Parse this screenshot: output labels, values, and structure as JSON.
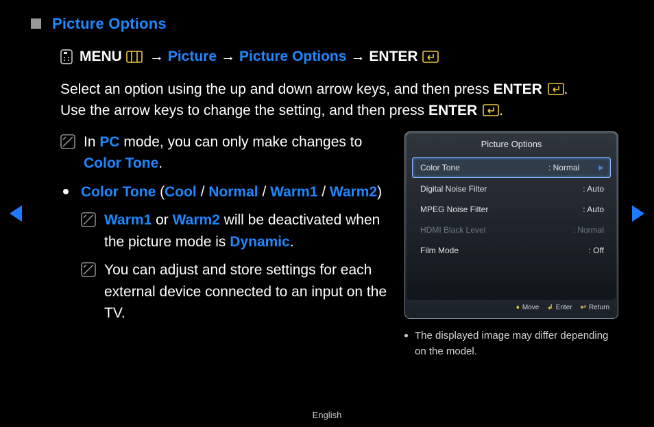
{
  "heading": {
    "title": "Picture Options"
  },
  "path": {
    "menu": "MENU",
    "picture": "Picture",
    "picture_options": "Picture Options",
    "enter": "ENTER",
    "arrow": "→"
  },
  "para": {
    "t1": "Select an option using the up and down arrow keys, and then press ",
    "enter1": "ENTER",
    "t2": ". Use the arrow keys to change the setting, and then press ",
    "enter2": "ENTER",
    "t3": "."
  },
  "note1": {
    "a": "In ",
    "pc": "PC",
    "b": " mode, you can only make changes to ",
    "ct": "Color Tone",
    "c": "."
  },
  "bullet": {
    "ct": "Color Tone",
    "open": " (",
    "cool": "Cool",
    "sep": " / ",
    "normal": "Normal",
    "warm1": "Warm1",
    "warm2": "Warm2",
    "close": ")"
  },
  "sub1": {
    "w1": "Warm1",
    "or": " or ",
    "w2": "Warm2",
    "rest": " will be deactivated when the picture mode is ",
    "dyn": "Dynamic",
    "dot": "."
  },
  "sub2": {
    "text": "You can adjust and store settings for each external device connected to an input on the TV."
  },
  "panel": {
    "title": "Picture Options",
    "items": [
      {
        "label": "Color Tone",
        "value": ": Normal",
        "state": "selected"
      },
      {
        "label": "Digital Noise Filter",
        "value": ": Auto",
        "state": ""
      },
      {
        "label": "MPEG Noise Filter",
        "value": ": Auto",
        "state": ""
      },
      {
        "label": "HDMI Black Level",
        "value": ": Normal",
        "state": "disabled"
      },
      {
        "label": "Film Mode",
        "value": ": Off",
        "state": ""
      }
    ],
    "footer": {
      "move": "Move",
      "enter": "Enter",
      "return": "Return"
    }
  },
  "img_note": "The displayed image may differ depending on the model.",
  "footer_lang": "English"
}
